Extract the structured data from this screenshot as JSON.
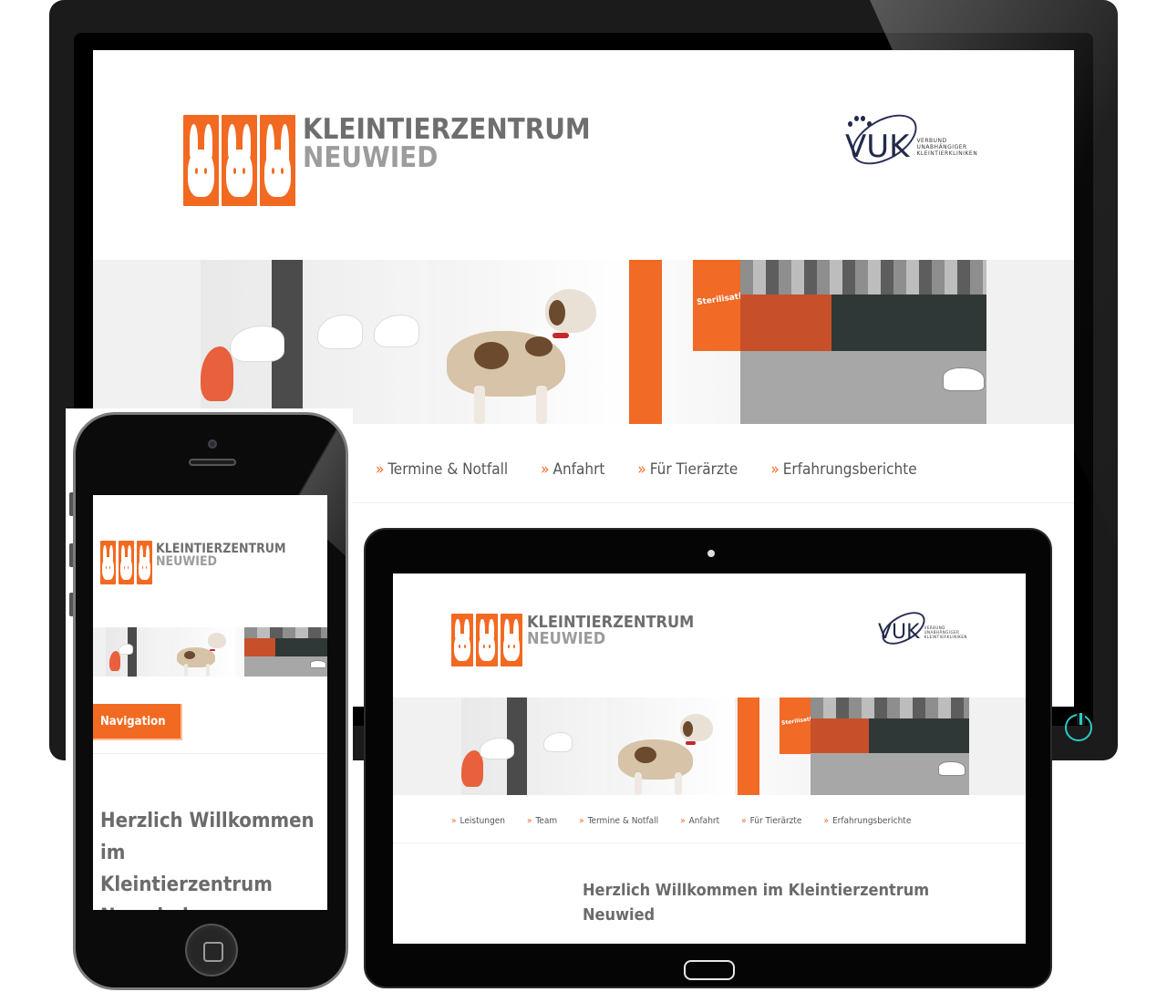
{
  "brand": {
    "name_line1": "KLEINTIERZENTRUM",
    "name_line2": "NEUWIED",
    "accent_color": "#f26a21"
  },
  "partner_logo": {
    "letters": "VUK",
    "line1": "VERBUND",
    "line2": "UNABHÄNGIGER",
    "line3": "KLEINTIERKLINIKEN"
  },
  "banner": {
    "sign_text": "Sterilisation"
  },
  "desktop": {
    "nav": [
      {
        "label": "Termine & Notfall"
      },
      {
        "label": "Anfahrt"
      },
      {
        "label": "Für Tierärzte"
      },
      {
        "label": "Erfahrungsberichte"
      }
    ]
  },
  "tablet": {
    "nav": [
      {
        "label": "Leistungen"
      },
      {
        "label": "Team"
      },
      {
        "label": "Termine & Notfall"
      },
      {
        "label": "Anfahrt"
      },
      {
        "label": "Für Tierärzte"
      },
      {
        "label": "Erfahrungsberichte"
      }
    ],
    "welcome_line1": "Herzlich Willkommen im Kleintierzentrum",
    "welcome_line2": "Neuwied"
  },
  "phone": {
    "nav_button": "Navigation",
    "welcome_line1": "Herzlich Willkommen im",
    "welcome_line2": "Kleintierzentrum",
    "welcome_line3": "Neuwied"
  },
  "icons": {
    "nav_chevron": "»",
    "power": "power-icon"
  }
}
